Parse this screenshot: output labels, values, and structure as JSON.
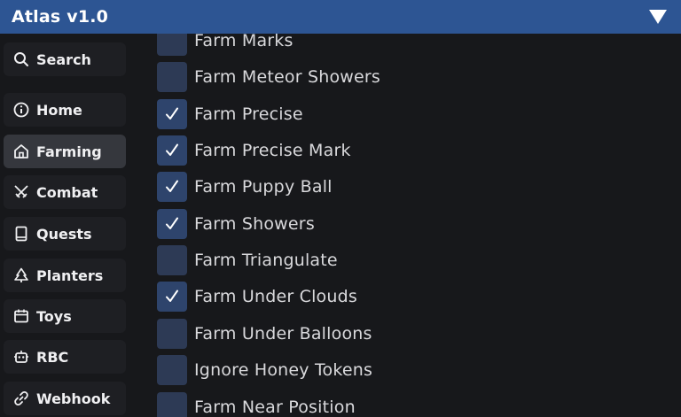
{
  "window": {
    "title": "Atlas v1.0",
    "collapse_icon": "triangle-down-icon"
  },
  "sidebar": {
    "search": {
      "label": "Search",
      "icon": "search-icon"
    },
    "items": [
      {
        "label": "Home",
        "icon": "info-icon",
        "active": false
      },
      {
        "label": "Farming",
        "icon": "house-icon",
        "active": true
      },
      {
        "label": "Combat",
        "icon": "crossed-swords-icon",
        "active": false
      },
      {
        "label": "Quests",
        "icon": "book-icon",
        "active": false
      },
      {
        "label": "Planters",
        "icon": "tree-icon",
        "active": false
      },
      {
        "label": "Toys",
        "icon": "calendar-icon",
        "active": false
      },
      {
        "label": "RBC",
        "icon": "robot-icon",
        "active": false
      },
      {
        "label": "Webhook",
        "icon": "link-icon",
        "active": false
      }
    ]
  },
  "main": {
    "toggles": [
      {
        "label": "Farm Marks",
        "checked": false
      },
      {
        "label": "Farm Meteor Showers",
        "checked": false
      },
      {
        "label": "Farm Precise",
        "checked": true
      },
      {
        "label": "Farm Precise Mark",
        "checked": true
      },
      {
        "label": "Farm Puppy Ball",
        "checked": true
      },
      {
        "label": "Farm Showers",
        "checked": true
      },
      {
        "label": "Farm Triangulate",
        "checked": false
      },
      {
        "label": "Farm Under Clouds",
        "checked": true
      },
      {
        "label": "Farm Under Balloons",
        "checked": false
      },
      {
        "label": "Ignore Honey Tokens",
        "checked": false
      },
      {
        "label": "Farm Near Position",
        "checked": false
      }
    ]
  },
  "colors": {
    "titlebar": "#2d5593",
    "background": "#17181b",
    "checkbox": "#2d3a55"
  }
}
